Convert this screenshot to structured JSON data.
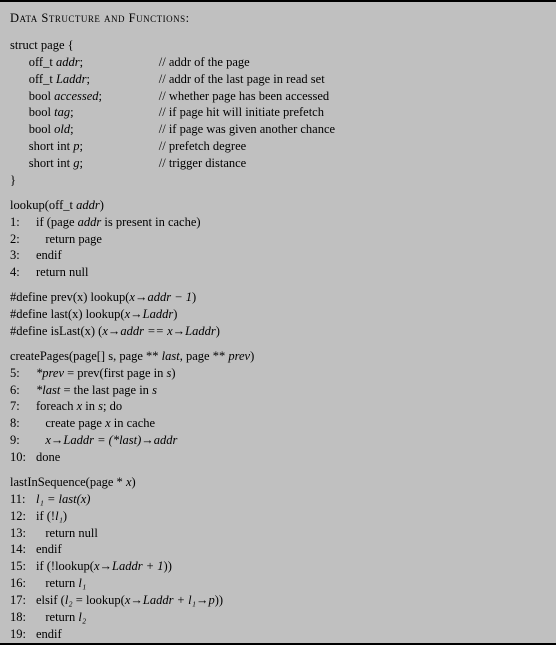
{
  "title": "Data Structure and Functions:",
  "struct": {
    "open": "struct page {",
    "close": "}",
    "fields": [
      {
        "decl": "off_t addr;",
        "comment": "// addr of the page"
      },
      {
        "decl": "off_t Laddr;",
        "comment": "// addr of the last page in read set"
      },
      {
        "decl": "bool accessed;",
        "comment": "// whether page has been accessed"
      },
      {
        "decl": "bool tag;",
        "comment": "// if page hit will initiate prefetch"
      },
      {
        "decl": "bool old;",
        "comment": "// if page was given another chance"
      },
      {
        "decl": "short int p;",
        "comment": "// prefetch degree"
      },
      {
        "decl": "short int g;",
        "comment": "// trigger distance"
      }
    ]
  },
  "lookup": {
    "sig_pre": "lookup(off_t ",
    "sig_arg": "addr",
    "sig_post": ")",
    "l1a": "if (page ",
    "l1b": "addr",
    "l1c": " is present in cache)",
    "l2": "return page",
    "l3": "endif",
    "l4": "return null"
  },
  "defines": {
    "d1a": "#define prev(x) lookup(",
    "d1b": "x→addr − 1",
    "d1c": ")",
    "d2a": "#define last(x) lookup(",
    "d2b": "x→Laddr",
    "d2c": ")",
    "d3a": "#define isLast(x) (",
    "d3b": "x→addr == x→Laddr",
    "d3c": ")"
  },
  "createPages": {
    "sig_a": "createPages(page[] s, page ** ",
    "sig_b": "last",
    "sig_c": ", page ** ",
    "sig_d": "prev",
    "sig_e": ")",
    "l5a": "*prev",
    "l5b": " = prev(first page in ",
    "l5c": "s",
    "l5d": ")",
    "l6a": "*last",
    "l6b": " = the last page in ",
    "l6c": "s",
    "l7a": "foreach ",
    "l7b": "x",
    "l7c": " in ",
    "l7d": "s",
    "l7e": "; do",
    "l8a": "create page ",
    "l8b": "x",
    "l8c": " in cache",
    "l9a": "x→Laddr = (*last)→addr",
    "l10": "done"
  },
  "lastIn": {
    "sig_a": "lastInSequence(page * ",
    "sig_b": "x",
    "sig_c": ")",
    "l11a": "l₁ = last(x)",
    "l12a": "if (!",
    "l12b": "l₁",
    "l12c": ")",
    "l13": "return null",
    "l14": "endif",
    "l15a": "if (!lookup(",
    "l15b": "x→Laddr + 1",
    "l15c": "))",
    "l16a": "return ",
    "l16b": "l₁",
    "l17a": "elsif (",
    "l17b": "l₂",
    "l17c": " = lookup(",
    "l17d": "x→Laddr + l₁→p",
    "l17e": "))",
    "l18a": "return ",
    "l18b": "l₂",
    "l19": "endif"
  },
  "nums": {
    "n1": "1:",
    "n2": "2:",
    "n3": "3:",
    "n4": "4:",
    "n5": "5:",
    "n6": "6:",
    "n7": "7:",
    "n8": "8:",
    "n9": "9:",
    "n10": "10:",
    "n11": "11:",
    "n12": "12:",
    "n13": "13:",
    "n14": "14:",
    "n15": "15:",
    "n16": "16:",
    "n17": "17:",
    "n18": "18:",
    "n19": "19:"
  }
}
